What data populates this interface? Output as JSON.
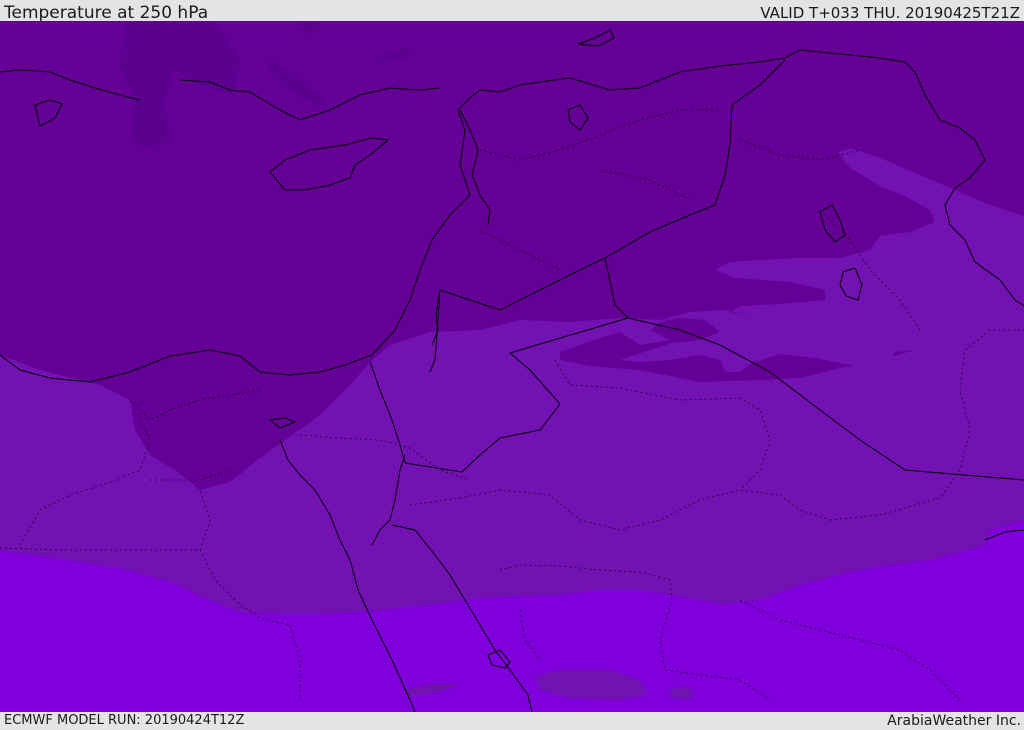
{
  "header": {
    "title": "Temperature at 250 hPa",
    "valid": "VALID T+033 THU. 20190425T21Z"
  },
  "footer": {
    "model_run": "ECMWF MODEL RUN: 20190424T12Z",
    "credit": "ArabiaWeather Inc."
  },
  "colors": {
    "band_coldest": "#5c0090",
    "band_cold": "#640096",
    "band_mid": "#7212b2",
    "band_warm": "#8000dc",
    "coast": "#000000",
    "border": "#000000"
  }
}
